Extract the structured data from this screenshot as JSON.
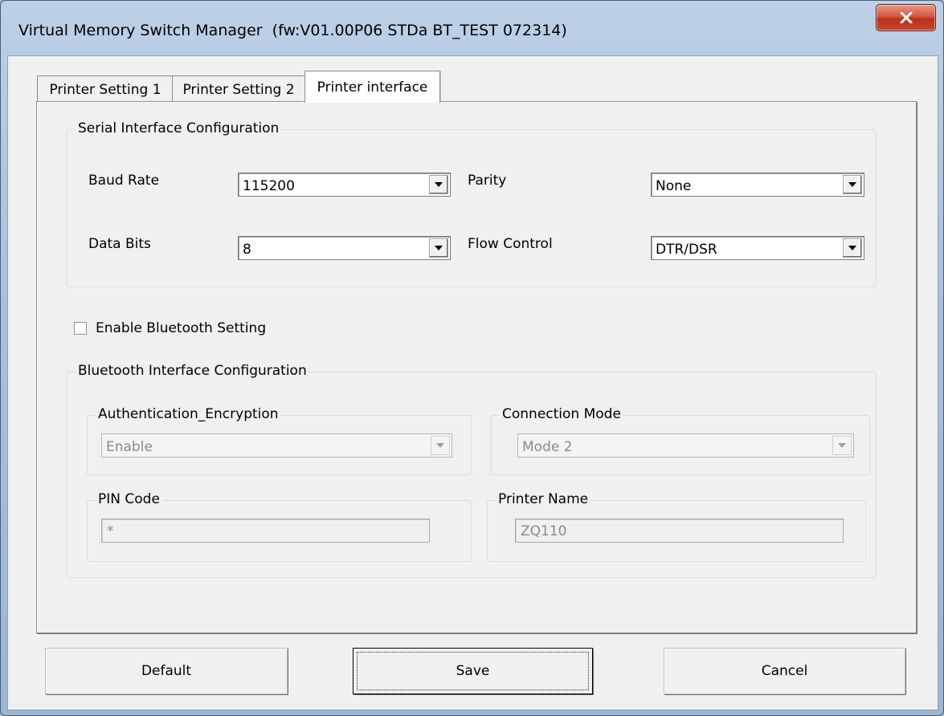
{
  "window": {
    "title": "Virtual Memory Switch Manager",
    "firmware": "(fw:V01.00P06 STDa BT_TEST 072314)"
  },
  "tabs": [
    {
      "label": "Printer Setting 1",
      "active": false
    },
    {
      "label": "Printer Setting 2",
      "active": false
    },
    {
      "label": "Printer interface",
      "active": true
    }
  ],
  "serial": {
    "group_label": "Serial Interface Configuration",
    "baud_rate": {
      "label": "Baud Rate",
      "value": "115200"
    },
    "parity": {
      "label": "Parity",
      "value": "None"
    },
    "data_bits": {
      "label": "Data Bits",
      "value": "8"
    },
    "flow_control": {
      "label": "Flow Control",
      "value": "DTR/DSR"
    }
  },
  "bluetooth": {
    "enable_label": "Enable Bluetooth Setting",
    "enabled": false,
    "group_label": "Bluetooth Interface Configuration",
    "auth": {
      "label": "Authentication_Encryption",
      "value": "Enable"
    },
    "connection": {
      "label": "Connection Mode",
      "value": "Mode 2"
    },
    "pin": {
      "label": "PIN Code",
      "value": "*"
    },
    "printer_name": {
      "label": "Printer Name",
      "value": "ZQ110"
    }
  },
  "buttons": {
    "default": "Default",
    "save": "Save",
    "cancel": "Cancel"
  },
  "icons": {
    "close": "close-icon",
    "dropdown": "chevron-down-icon"
  },
  "colors": {
    "close_button": "#c5452d",
    "dialog_face": "#f0f0f0",
    "title_bar": "#a9c1dc"
  }
}
